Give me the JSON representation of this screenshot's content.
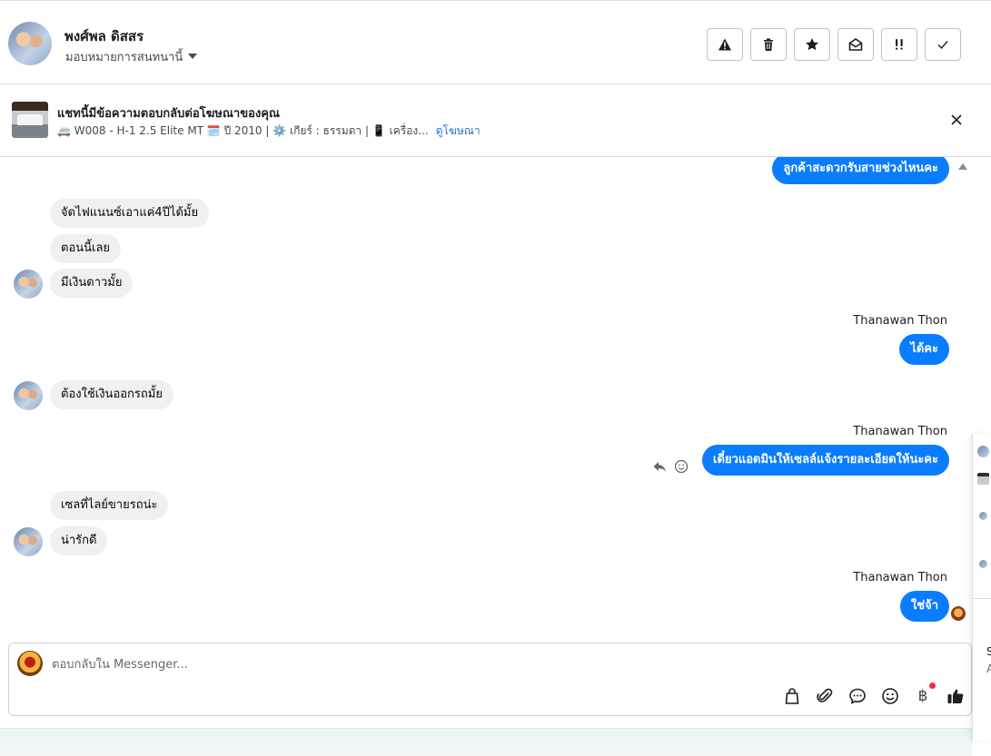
{
  "header": {
    "contact_name": "พงศ์พล ดิสสร",
    "assign_label": "มอบหมายการสนทนานี้",
    "toolbar": [
      {
        "name": "report-spam-button",
        "icon": "warning-icon"
      },
      {
        "name": "delete-button",
        "icon": "trash-icon"
      },
      {
        "name": "star-button",
        "icon": "star-icon"
      },
      {
        "name": "mark-unread-button",
        "icon": "envelope-open-icon"
      },
      {
        "name": "follow-up-button",
        "icon": "exclamation-icon"
      },
      {
        "name": "mark-done-button",
        "icon": "check-icon"
      }
    ]
  },
  "ad": {
    "title": "แชทนี้มีข้อความตอบกลับต่อโฆษณาของคุณ",
    "meta": "🚐 W008 - H-1 2.5 Elite MT 🗓️ ปี 2010 | ⚙️ เกียร์ : ธรรมดา | 📱 เครื่อง...",
    "link": "ดูโฆษณา"
  },
  "messages": {
    "out_top": "ลูกค้าสะดวกรับสายช่วงไหนคะ",
    "in_1": "จัดไฟแนนซ์เอาแค่4ปีได้มั้ย",
    "in_2": "ตอนนี้เลย",
    "in_3": "มีเงินดาวมั้ย",
    "sender_1": "Thanawan Thon",
    "out_1": "ได้คะ",
    "in_4": "ต้องใช้เงินออกรถมั้ย",
    "sender_2": "Thanawan Thon",
    "out_2": "เดี๋ยวแอดมินให้เซลล์แจ้งรายละเอียดให้นะคะ",
    "in_5": "เซลที่ไลย์ขายรถน่ะ",
    "in_6": "น่ารักดี",
    "sender_3": "Thanawan Thon",
    "out_3": "ใช่จ้า"
  },
  "composer": {
    "placeholder": "ตอบกลับใน Messenger...",
    "baht_symbol": "฿",
    "tools": [
      "bag-icon",
      "attachment-icon",
      "saved-reply-icon",
      "emoji-icon",
      "baht-icon",
      "thumbs-up-icon"
    ]
  },
  "side_panel": {
    "text_1": "S",
    "text_2": "A"
  },
  "colors": {
    "outgoing_bubble": "#0a7cff",
    "incoming_bubble": "#f0f0f0",
    "link": "#216fdb",
    "notification_dot": "#f02849"
  }
}
